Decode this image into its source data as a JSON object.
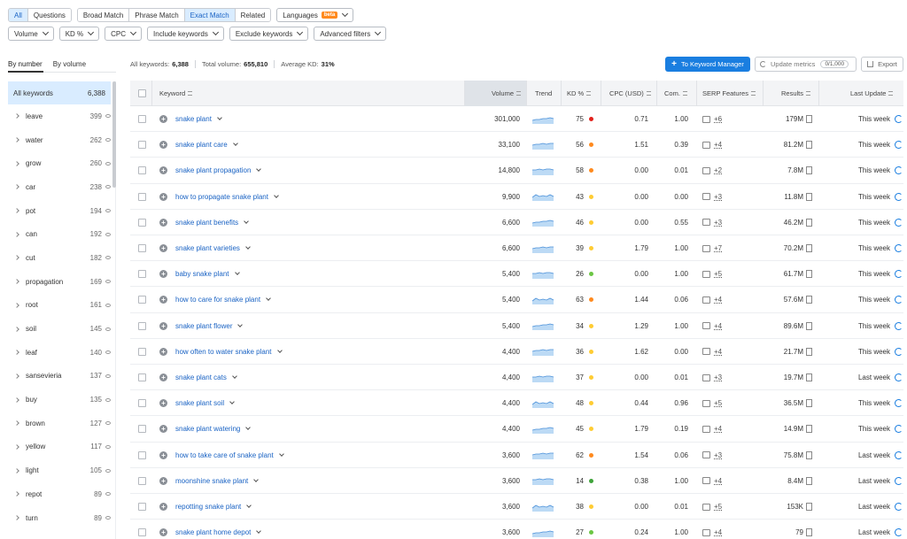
{
  "match_tabs": [
    "All",
    "Questions",
    "Broad Match",
    "Phrase Match",
    "Exact Match",
    "Related"
  ],
  "match_tabs_selected": [
    "All",
    "Exact Match"
  ],
  "languages": {
    "label": "Languages",
    "badge": "beta"
  },
  "filters": [
    "Volume",
    "KD %",
    "CPC",
    "Include keywords",
    "Exclude keywords",
    "Advanced filters"
  ],
  "sidebar": {
    "tabs": [
      "By number",
      "By volume"
    ],
    "all": {
      "label": "All keywords",
      "count": "6,388"
    },
    "items": [
      {
        "label": "leave",
        "count": "399"
      },
      {
        "label": "water",
        "count": "262"
      },
      {
        "label": "grow",
        "count": "260"
      },
      {
        "label": "car",
        "count": "238"
      },
      {
        "label": "pot",
        "count": "194"
      },
      {
        "label": "can",
        "count": "192"
      },
      {
        "label": "cut",
        "count": "182"
      },
      {
        "label": "propagation",
        "count": "169"
      },
      {
        "label": "root",
        "count": "161"
      },
      {
        "label": "soil",
        "count": "145"
      },
      {
        "label": "leaf",
        "count": "140"
      },
      {
        "label": "sansevieria",
        "count": "137"
      },
      {
        "label": "buy",
        "count": "135"
      },
      {
        "label": "brown",
        "count": "127"
      },
      {
        "label": "yellow",
        "count": "117"
      },
      {
        "label": "light",
        "count": "105"
      },
      {
        "label": "repot",
        "count": "89"
      },
      {
        "label": "turn",
        "count": "89"
      }
    ]
  },
  "stats": {
    "all_keywords_label": "All keywords:",
    "all_keywords": "6,388",
    "total_volume_label": "Total volume:",
    "total_volume": "655,810",
    "avg_kd_label": "Average KD:",
    "avg_kd": "31%"
  },
  "actions": {
    "to_keyword_manager": "To Keyword Manager",
    "update_metrics": "Update metrics",
    "quota": "0/1,000",
    "export": "Export"
  },
  "table": {
    "headers": {
      "keyword": "Keyword",
      "volume": "Volume",
      "trend": "Trend",
      "kd": "KD %",
      "cpc": "CPC (USD)",
      "com": "Com.",
      "serp": "SERP Features",
      "results": "Results",
      "last_update": "Last Update"
    },
    "rows": [
      {
        "keyword": "snake plant",
        "volume": "301,000",
        "kd": "75",
        "kd_color": "#e2211c",
        "cpc": "0.71",
        "com": "1.00",
        "serp_icon": "graduation-cap-icon",
        "serp": "+6",
        "results": "179M",
        "update": "This week"
      },
      {
        "keyword": "snake plant care",
        "volume": "33,100",
        "kd": "56",
        "kd_color": "#ff8a1e",
        "cpc": "1.51",
        "com": "0.39",
        "serp_icon": "link-icon",
        "serp": "+4",
        "results": "81.2M",
        "update": "This week"
      },
      {
        "keyword": "snake plant propagation",
        "volume": "14,800",
        "kd": "58",
        "kd_color": "#ff8a1e",
        "cpc": "0.00",
        "com": "0.01",
        "serp_icon": "video-icon",
        "serp": "+2",
        "results": "7.8M",
        "update": "This week"
      },
      {
        "keyword": "how to propagate snake plant",
        "volume": "9,900",
        "kd": "43",
        "kd_color": "#ffcc33",
        "cpc": "0.00",
        "com": "0.00",
        "serp_icon": "image-icon",
        "serp": "+3",
        "results": "11.8M",
        "update": "This week"
      },
      {
        "keyword": "snake plant benefits",
        "volume": "6,600",
        "kd": "46",
        "kd_color": "#ffcc33",
        "cpc": "0.00",
        "com": "0.55",
        "serp_icon": "star-icon",
        "serp": "+3",
        "results": "46.2M",
        "update": "This week"
      },
      {
        "keyword": "snake plant varieties",
        "volume": "6,600",
        "kd": "39",
        "kd_color": "#ffcc33",
        "cpc": "1.79",
        "com": "1.00",
        "serp_icon": "graduation-cap-icon",
        "serp": "+7",
        "results": "70.2M",
        "update": "This week"
      },
      {
        "keyword": "baby snake plant",
        "volume": "5,400",
        "kd": "26",
        "kd_color": "#6cc644",
        "cpc": "0.00",
        "com": "1.00",
        "serp_icon": "image-icon",
        "serp": "+5",
        "results": "61.7M",
        "update": "This week"
      },
      {
        "keyword": "how to care for snake plant",
        "volume": "5,400",
        "kd": "63",
        "kd_color": "#ff8a1e",
        "cpc": "1.44",
        "com": "0.06",
        "serp_icon": "image-icon",
        "serp": "+4",
        "results": "57.6M",
        "update": "This week"
      },
      {
        "keyword": "snake plant flower",
        "volume": "5,400",
        "kd": "34",
        "kd_color": "#ffcc33",
        "cpc": "1.29",
        "com": "1.00",
        "serp_icon": "graduation-cap-icon",
        "serp": "+4",
        "results": "89.6M",
        "update": "This week"
      },
      {
        "keyword": "how often to water snake plant",
        "volume": "4,400",
        "kd": "36",
        "kd_color": "#ffcc33",
        "cpc": "1.62",
        "com": "0.00",
        "serp_icon": "image-icon",
        "serp": "+4",
        "results": "21.7M",
        "update": "This week"
      },
      {
        "keyword": "snake plant cats",
        "volume": "4,400",
        "kd": "37",
        "kd_color": "#ffcc33",
        "cpc": "0.00",
        "com": "0.01",
        "serp_icon": "link-icon",
        "serp": "+3",
        "results": "19.7M",
        "update": "Last week"
      },
      {
        "keyword": "snake plant soil",
        "volume": "4,400",
        "kd": "48",
        "kd_color": "#ffcc33",
        "cpc": "0.44",
        "com": "0.96",
        "serp_icon": "link-icon",
        "serp": "+5",
        "results": "36.5M",
        "update": "This week"
      },
      {
        "keyword": "snake plant watering",
        "volume": "4,400",
        "kd": "45",
        "kd_color": "#ffcc33",
        "cpc": "1.79",
        "com": "0.19",
        "serp_icon": "image-icon",
        "serp": "+4",
        "results": "14.9M",
        "update": "This week"
      },
      {
        "keyword": "how to take care of snake plant",
        "volume": "3,600",
        "kd": "62",
        "kd_color": "#ff8a1e",
        "cpc": "1.54",
        "com": "0.06",
        "serp_icon": "image-icon",
        "serp": "+3",
        "results": "75.8M",
        "update": "Last week"
      },
      {
        "keyword": "moonshine snake plant",
        "volume": "3,600",
        "kd": "14",
        "kd_color": "#3fa33a",
        "cpc": "0.38",
        "com": "1.00",
        "serp_icon": "image-icon",
        "serp": "+4",
        "results": "8.4M",
        "update": "Last week"
      },
      {
        "keyword": "repotting snake plant",
        "volume": "3,600",
        "kd": "38",
        "kd_color": "#ffcc33",
        "cpc": "0.00",
        "com": "0.01",
        "serp_icon": "image-icon",
        "serp": "+5",
        "results": "153K",
        "update": "Last week"
      },
      {
        "keyword": "snake plant home depot",
        "volume": "3,600",
        "kd": "27",
        "kd_color": "#6cc644",
        "cpc": "0.24",
        "com": "1.00",
        "serp_icon": "image-icon",
        "serp": "+4",
        "results": "79",
        "update": "Last week"
      }
    ]
  }
}
